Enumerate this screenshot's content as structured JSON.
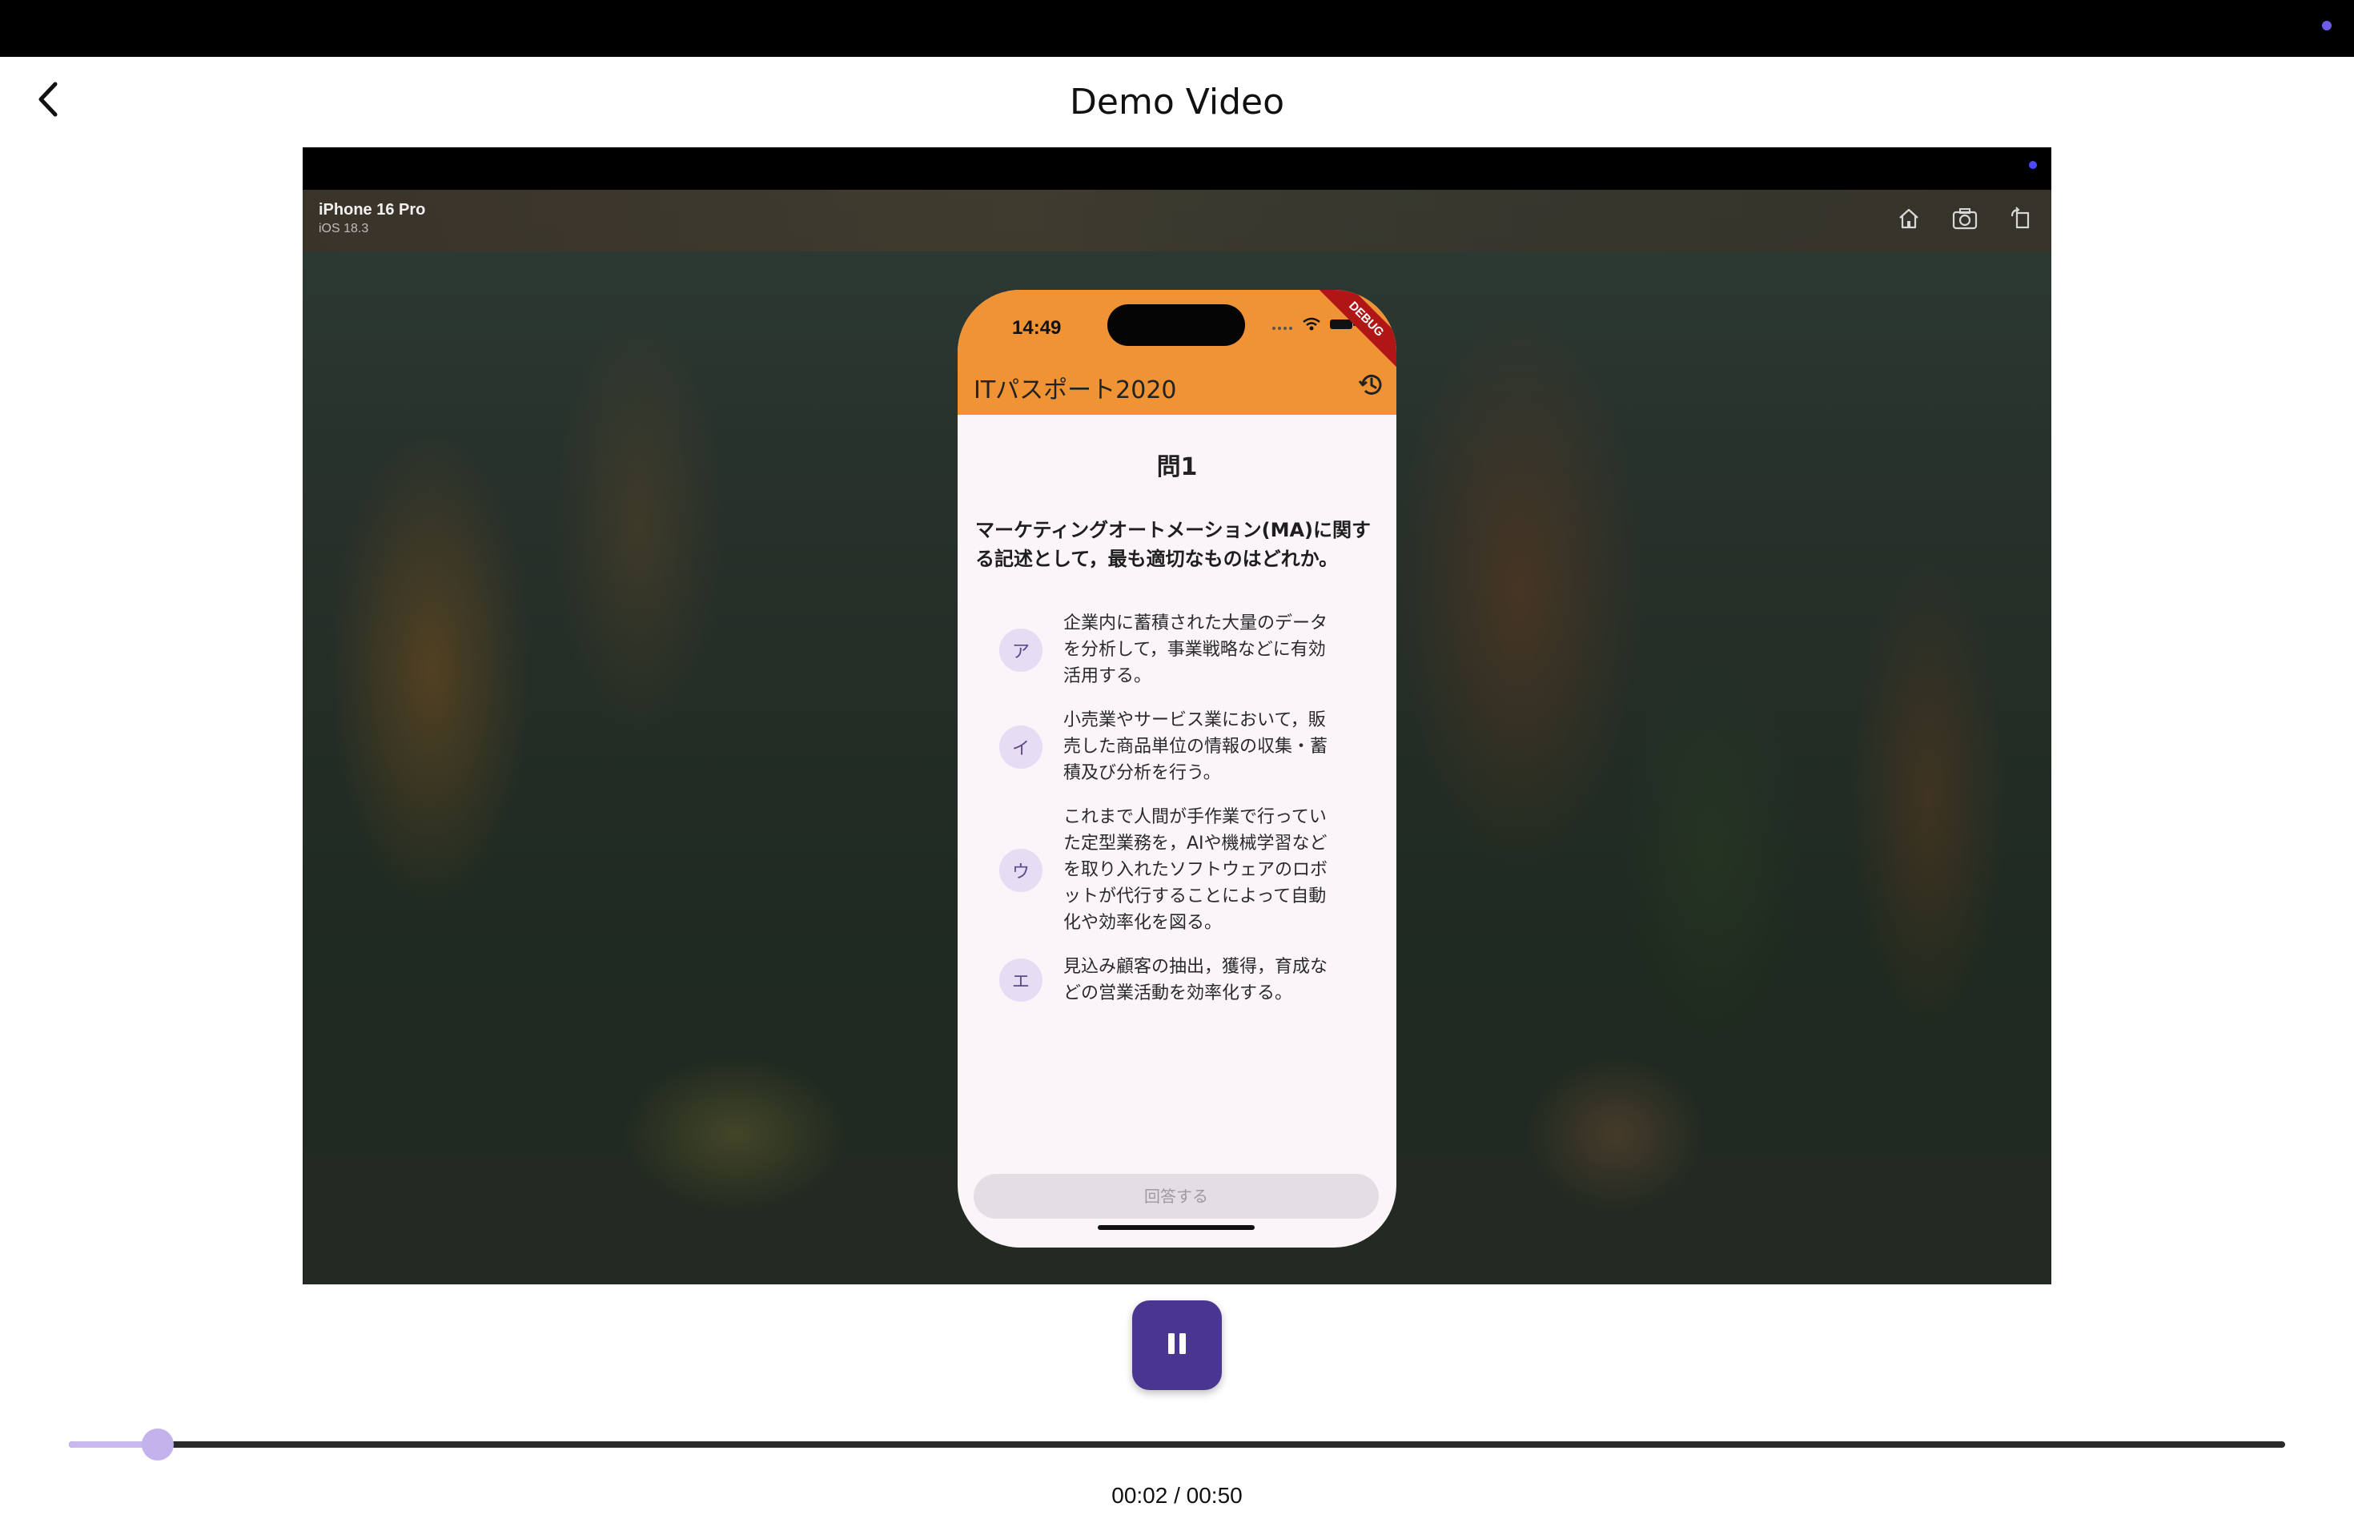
{
  "app": {
    "title": "Demo Video"
  },
  "icons": {
    "back": "back-arrow-icon",
    "sim_home": "home-icon",
    "sim_screenshot": "camera-icon",
    "sim_rotate": "rotate-icon",
    "history": "history-icon",
    "pause": "pause-icon"
  },
  "simulator": {
    "device_name": "iPhone 16 Pro",
    "os_version": "iOS 18.3"
  },
  "phone": {
    "time": "14:49",
    "debug_banner": "DEBUG",
    "app_bar_title": "ITパスポート2020",
    "accent_color": "#ef9335",
    "question": {
      "number": "問1",
      "text": "マーケティングオートメーション(MA)に関する記述として，最も適切なものはどれか。",
      "choices": [
        {
          "label": "ア",
          "text": "企業内に蓄積された大量のデータを分析して，事業戦略などに有効活用する。"
        },
        {
          "label": "イ",
          "text": "小売業やサービス業において，販売した商品単位の情報の収集・蓄積及び分析を行う。"
        },
        {
          "label": "ウ",
          "text": "これまで人間が手作業で行っていた定型業務を，AIや機械学習などを取り入れたソフトウェアのロボットが代行することによって自動化や効率化を図る。"
        },
        {
          "label": "エ",
          "text": "見込み顧客の抽出，獲得，育成などの営業活動を効率化する。"
        }
      ],
      "answer_button": "回答する"
    }
  },
  "player": {
    "current_time": "00:02",
    "total_time": "00:50",
    "time_display": "00:02 / 00:50",
    "progress_fraction": 0.04,
    "button_color": "#4a3691"
  }
}
